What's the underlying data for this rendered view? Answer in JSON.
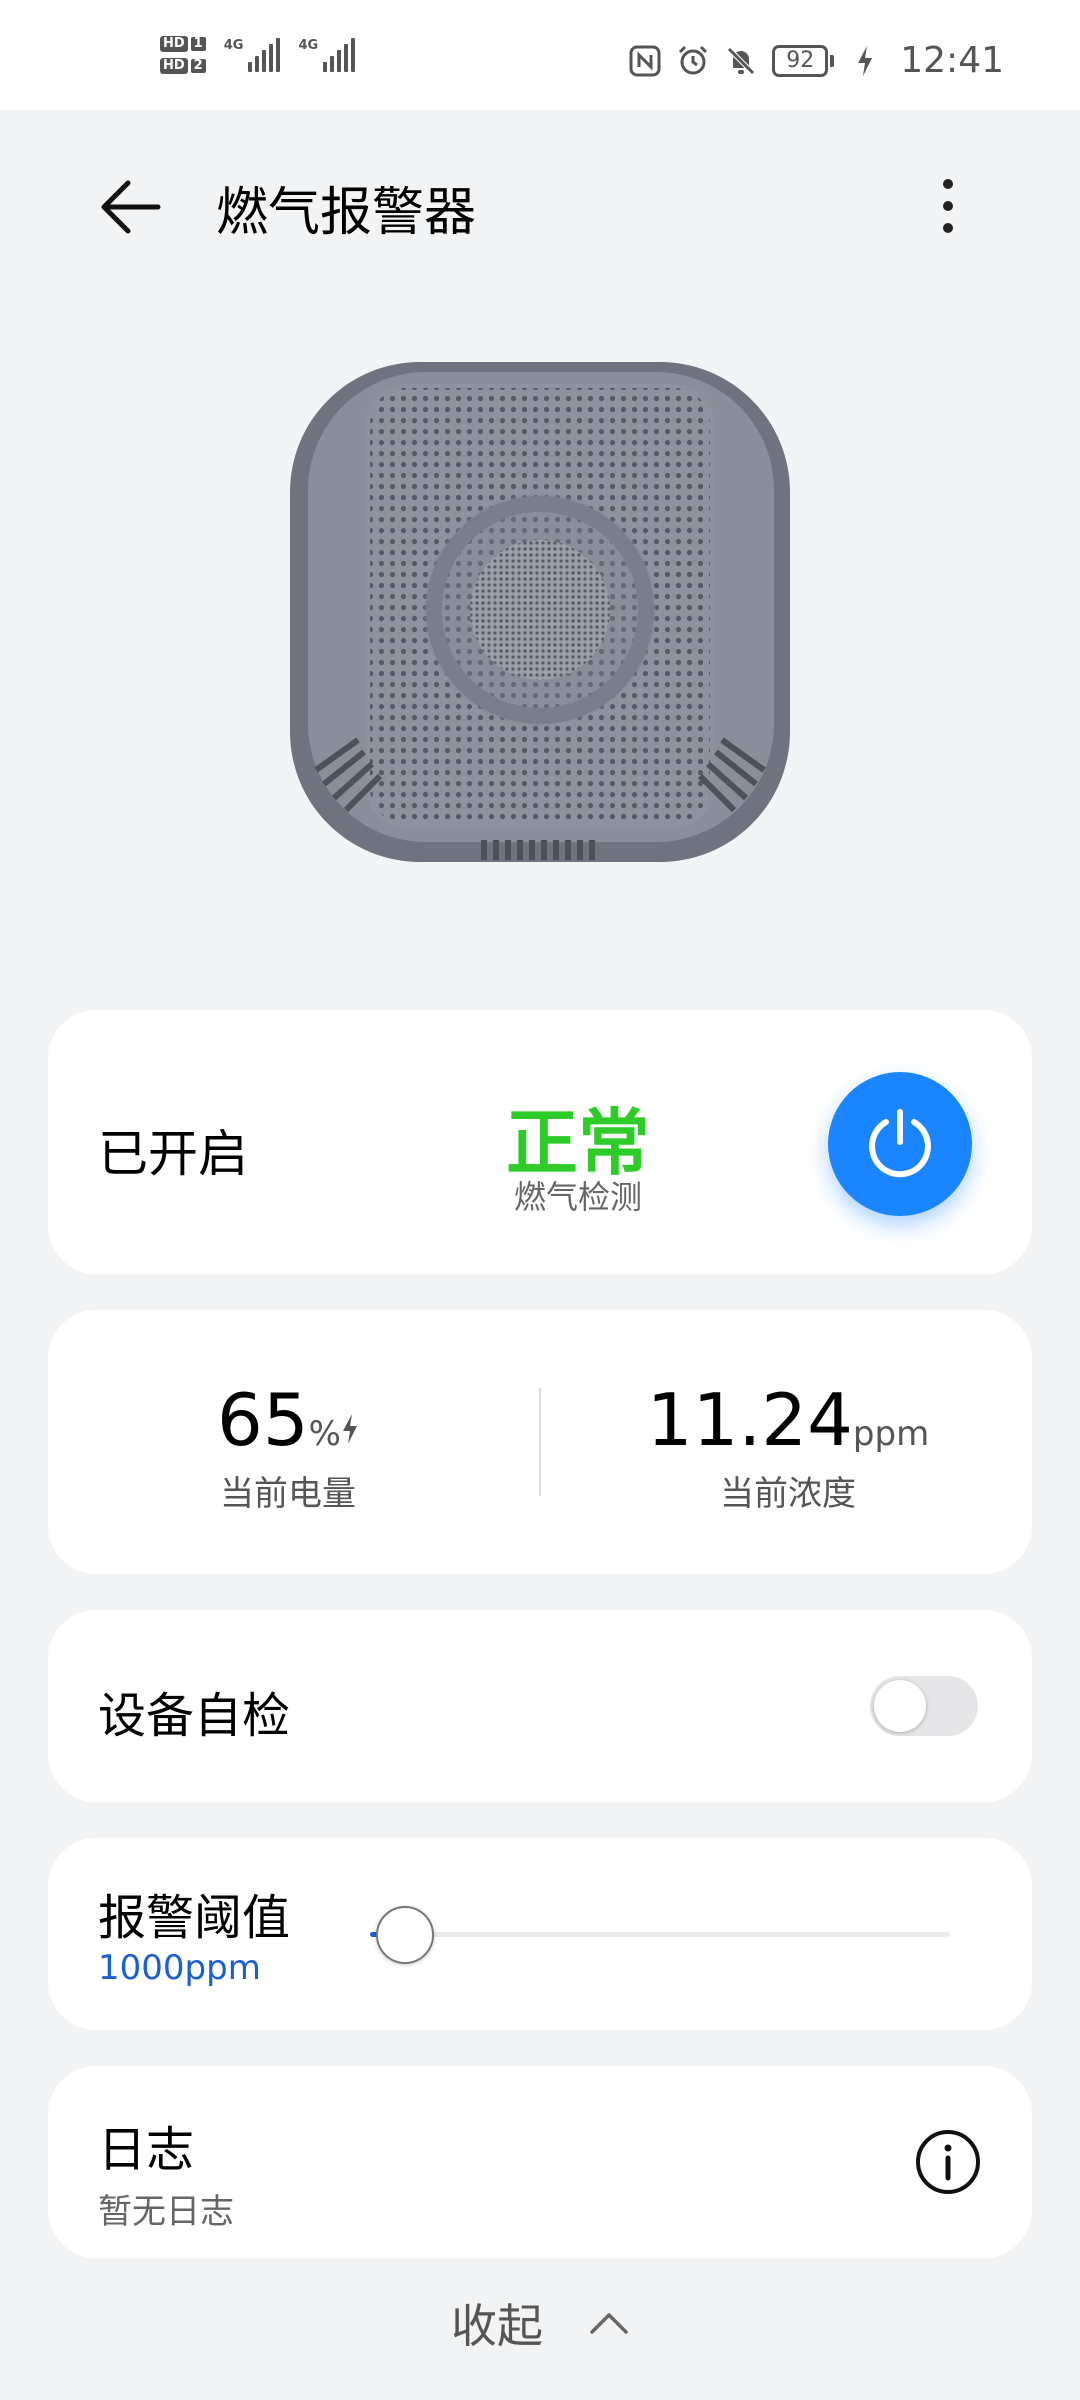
{
  "status_bar": {
    "hd1": "HD",
    "hd1_num": "1",
    "hd2": "HD",
    "hd2_num": "2",
    "sig1": "4G",
    "sig2": "4G",
    "battery": "92",
    "time": "12:41"
  },
  "app_bar": {
    "title": "燃气报警器"
  },
  "status_card": {
    "state": "已开启",
    "status": "正常",
    "status_label": "燃气检测",
    "status_color": "#2ecc29",
    "power_color": "#1a85ff"
  },
  "metrics": {
    "battery_value": "65",
    "battery_unit": "%",
    "battery_label": "当前电量",
    "conc_value": "11.24",
    "conc_unit": "ppm",
    "conc_label": "当前浓度"
  },
  "self_test": {
    "label": "设备自检",
    "enabled": false
  },
  "threshold": {
    "label": "报警阈值",
    "value": "1000ppm",
    "slider_fraction": 0.06
  },
  "log": {
    "label": "日志",
    "sub": "暂无日志"
  },
  "footer": {
    "collapse_label": "收起"
  }
}
